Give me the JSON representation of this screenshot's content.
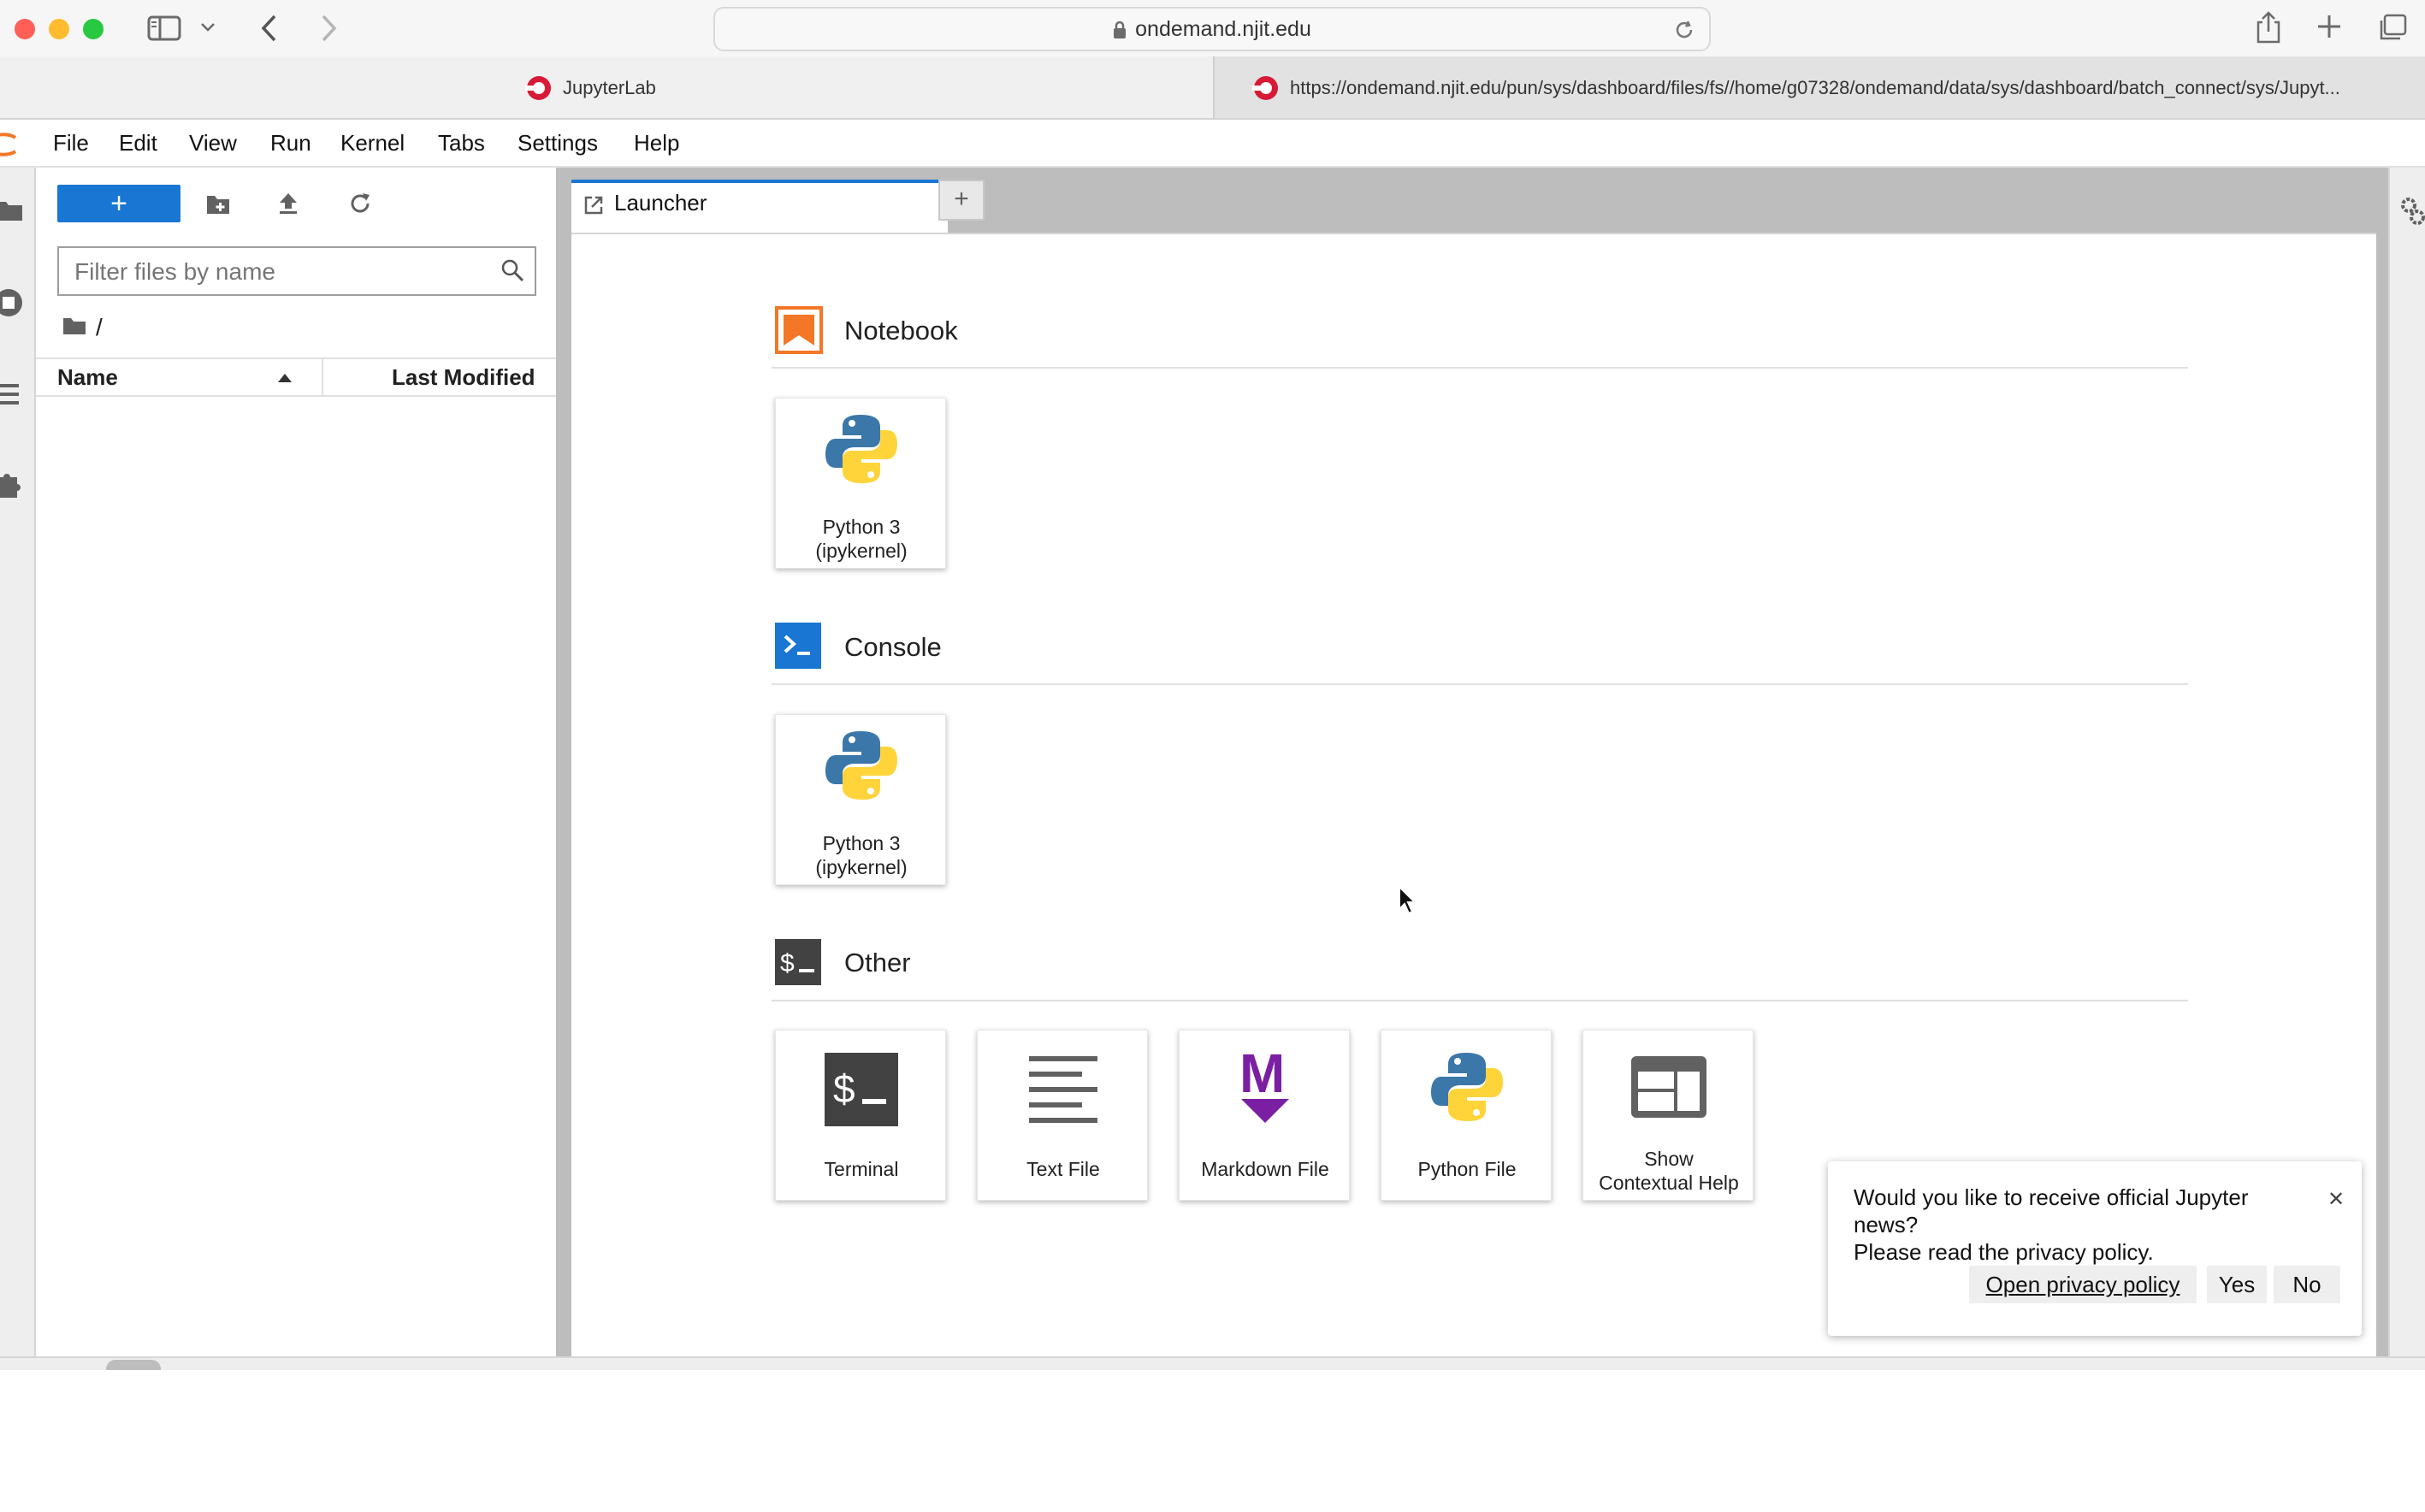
{
  "browser": {
    "url": "ondemand.njit.edu",
    "tabs": [
      {
        "title": "JupyterLab"
      },
      {
        "title": "https://ondemand.njit.edu/pun/sys/dashboard/files/fs//home/g07328/ondemand/data/sys/dashboard/batch_connect/sys/Jupyt..."
      }
    ]
  },
  "menubar": {
    "items": [
      "File",
      "Edit",
      "View",
      "Run",
      "Kernel",
      "Tabs",
      "Settings",
      "Help"
    ]
  },
  "filebrowser": {
    "new_button_label": "+",
    "filter_placeholder": "Filter files by name",
    "breadcrumb": "/",
    "columns": {
      "name": "Name",
      "modified": "Last Modified"
    }
  },
  "dock": {
    "active_tab": "Launcher",
    "add_tab_label": "+"
  },
  "launcher": {
    "notebook": {
      "title": "Notebook",
      "cards": [
        {
          "label": "Python 3\n(ipykernel)"
        }
      ]
    },
    "console": {
      "title": "Console",
      "cards": [
        {
          "label": "Python 3\n(ipykernel)"
        }
      ]
    },
    "other": {
      "title": "Other",
      "cards": [
        {
          "label": "Terminal"
        },
        {
          "label": "Text File"
        },
        {
          "label": "Markdown File"
        },
        {
          "label": "Python File"
        },
        {
          "label": "Show\nContextual Help"
        }
      ]
    }
  },
  "notification": {
    "message": "Would you like to receive official Jupyter\nnews?\nPlease read the privacy policy.",
    "link_label": "Open privacy policy",
    "yes_label": "Yes",
    "no_label": "No",
    "close_label": "✕"
  },
  "colors": {
    "accent": "#1976d2",
    "notebook_orange": "#f37726",
    "python_blue": "#3b77a8",
    "python_yellow": "#ffd43b",
    "markdown_purple": "#7b1fa2"
  }
}
